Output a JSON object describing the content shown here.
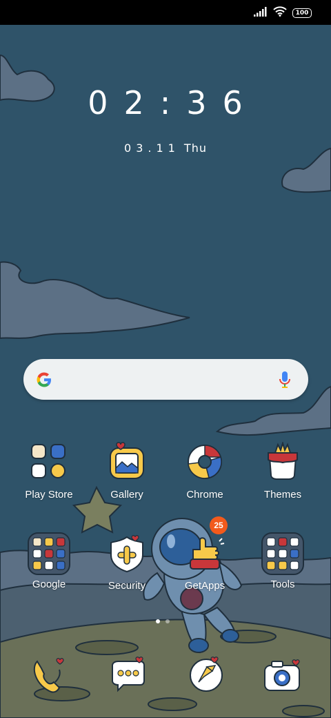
{
  "status_bar": {
    "battery_level": "100",
    "signal_icon": "signal-icon",
    "wifi_icon": "wifi-icon"
  },
  "clock": {
    "time": "02:36",
    "date_digits": "03.11",
    "weekday": "Thu"
  },
  "search_bar": {
    "logo_icon": "google-g-icon",
    "mic_icon": "microphone-icon"
  },
  "apps_row1": [
    {
      "label": "Play Store",
      "icon": "play-store-icon"
    },
    {
      "label": "Gallery",
      "icon": "gallery-icon"
    },
    {
      "label": "Chrome",
      "icon": "chrome-icon"
    },
    {
      "label": "Themes",
      "icon": "themes-icon"
    }
  ],
  "apps_row2": [
    {
      "label": "Google",
      "icon": "google-folder-icon"
    },
    {
      "label": "Security",
      "icon": "security-icon"
    },
    {
      "label": "GetApps",
      "icon": "getapps-icon",
      "badge": "25"
    },
    {
      "label": "Tools",
      "icon": "tools-folder-icon"
    }
  ],
  "dock": [
    {
      "icon": "phone-icon"
    },
    {
      "icon": "messages-icon"
    },
    {
      "icon": "browser-icon"
    },
    {
      "icon": "camera-icon"
    }
  ],
  "pager": {
    "pages": 2,
    "current": 1
  },
  "colors": {
    "sky": "#2f5369",
    "cloud": "#5c7085",
    "ground": "#6a7058",
    "badge": "#f25a1c",
    "accent_red": "#c8373a"
  }
}
